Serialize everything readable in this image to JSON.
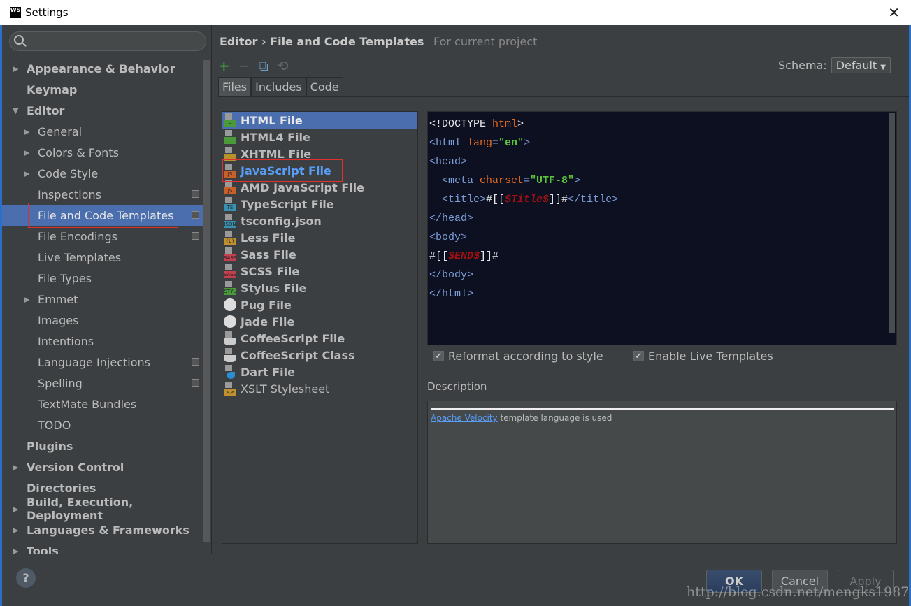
{
  "window": {
    "title": "Settings",
    "logo": "WS",
    "close": "✕"
  },
  "sidebar": {
    "search_placeholder": "",
    "items": [
      {
        "label": "Appearance & Behavior",
        "level": 0,
        "arrow": "▶",
        "bold": true
      },
      {
        "label": "Keymap",
        "level": 0,
        "bold": true
      },
      {
        "label": "Editor",
        "level": 0,
        "arrow": "▼",
        "bold": true
      },
      {
        "label": "General",
        "level": 1,
        "arrow": "▶"
      },
      {
        "label": "Colors & Fonts",
        "level": 1,
        "arrow": "▶"
      },
      {
        "label": "Code Style",
        "level": 1,
        "arrow": "▶"
      },
      {
        "label": "Inspections",
        "level": 1,
        "project": true
      },
      {
        "label": "File and Code Templates",
        "level": 1,
        "project": true,
        "selected": true
      },
      {
        "label": "File Encodings",
        "level": 1,
        "project": true
      },
      {
        "label": "Live Templates",
        "level": 1
      },
      {
        "label": "File Types",
        "level": 1
      },
      {
        "label": "Emmet",
        "level": 1,
        "arrow": "▶"
      },
      {
        "label": "Images",
        "level": 1
      },
      {
        "label": "Intentions",
        "level": 1
      },
      {
        "label": "Language Injections",
        "level": 1,
        "project": true
      },
      {
        "label": "Spelling",
        "level": 1,
        "project": true
      },
      {
        "label": "TextMate Bundles",
        "level": 1
      },
      {
        "label": "TODO",
        "level": 1
      },
      {
        "label": "Plugins",
        "level": 0,
        "bold": true
      },
      {
        "label": "Version Control",
        "level": 0,
        "arrow": "▶",
        "bold": true
      },
      {
        "label": "Directories",
        "level": 0,
        "bold": true
      },
      {
        "label": "Build, Execution, Deployment",
        "level": 0,
        "arrow": "▶",
        "bold": true
      },
      {
        "label": "Languages & Frameworks",
        "level": 0,
        "arrow": "▶",
        "bold": true
      },
      {
        "label": "Tools",
        "level": 0,
        "arrow": "▶",
        "bold": true
      }
    ]
  },
  "breadcrumb": {
    "parent": "Editor",
    "sep": "›",
    "current": "File and Code Templates",
    "scope": "For current project"
  },
  "toolbar": {
    "add": "+",
    "remove": "−",
    "copy": "⧉",
    "reset": "⟲"
  },
  "schema": {
    "label": "Schema:",
    "value": "Default",
    "arrow": "▼"
  },
  "tabs": [
    {
      "label": "Files",
      "active": true
    },
    {
      "label": "Includes"
    },
    {
      "label": "Code"
    }
  ],
  "files": [
    {
      "label": "HTML File",
      "icon": "H",
      "color": "#4a9a3c",
      "selected": true
    },
    {
      "label": "HTML4 File",
      "icon": "H",
      "color": "#4a9a3c"
    },
    {
      "label": "XHTML File",
      "icon": "H",
      "color": "#b8902c"
    },
    {
      "label": "JavaScript File",
      "icon": "JS",
      "color": "#c8602a",
      "highlight": true
    },
    {
      "label": "AMD JavaScript File",
      "icon": "JS",
      "color": "#c8602a"
    },
    {
      "label": "TypeScript File",
      "icon": "TS",
      "color": "#3a90b0"
    },
    {
      "label": "tsconfig.json",
      "icon": "JSON",
      "color": "#3a90b0"
    },
    {
      "label": "Less File",
      "icon": "{L}",
      "color": "#c09030"
    },
    {
      "label": "Sass File",
      "icon": "SASS",
      "color": "#c04050"
    },
    {
      "label": "SCSS File",
      "icon": "SASS",
      "color": "#c04050"
    },
    {
      "label": "Stylus File",
      "icon": "STYL",
      "color": "#4a9a3c"
    },
    {
      "label": "Pug File",
      "icon": "pug"
    },
    {
      "label": "Jade File",
      "icon": "pug"
    },
    {
      "label": "CoffeeScript File",
      "icon": "coffee"
    },
    {
      "label": "CoffeeScript Class",
      "icon": "coffee"
    },
    {
      "label": "Dart File",
      "icon": "dart"
    },
    {
      "label": "XSLT Stylesheet",
      "icon": "<>",
      "color": "#c09030",
      "normal": true
    }
  ],
  "code": [
    [
      [
        "w",
        "<!DOCTYPE "
      ],
      [
        "o",
        "html"
      ],
      [
        "w",
        ">"
      ]
    ],
    [
      [
        "t",
        "<html "
      ],
      [
        "o",
        "lang"
      ],
      [
        "t",
        "="
      ],
      [
        "g",
        "\"en\""
      ],
      [
        "t",
        ">"
      ]
    ],
    [
      [
        "t",
        "<head>"
      ]
    ],
    [
      [
        "t",
        "  <meta "
      ],
      [
        "o",
        "charset"
      ],
      [
        "t",
        "="
      ],
      [
        "g",
        "\"UTF-8\""
      ],
      [
        "t",
        ">"
      ]
    ],
    [
      [
        "t",
        "  <title>"
      ],
      [
        "w",
        "#[["
      ],
      [
        "r",
        "$Title$"
      ],
      [
        "w",
        "]]#"
      ],
      [
        "t",
        "</title>"
      ]
    ],
    [
      [
        "t",
        "</head>"
      ]
    ],
    [
      [
        "t",
        "<body>"
      ]
    ],
    [
      [
        "w",
        "#[["
      ],
      [
        "r",
        "$END$"
      ],
      [
        "w",
        "]]#"
      ]
    ],
    [
      [
        "t",
        "</body>"
      ]
    ],
    [
      [
        "t",
        "</html>"
      ]
    ]
  ],
  "options": {
    "reformat": {
      "label": "Reformat according to style",
      "checked": true
    },
    "live": {
      "label": "Enable Live Templates",
      "checked": true
    }
  },
  "description": {
    "label": "Description",
    "link": "Apache Velocity",
    "text": " template language is used"
  },
  "footer": {
    "help": "?",
    "ok": "OK",
    "cancel": "Cancel",
    "apply": "Apply"
  },
  "watermark": "http://blog.csdn.net/mengks1987"
}
